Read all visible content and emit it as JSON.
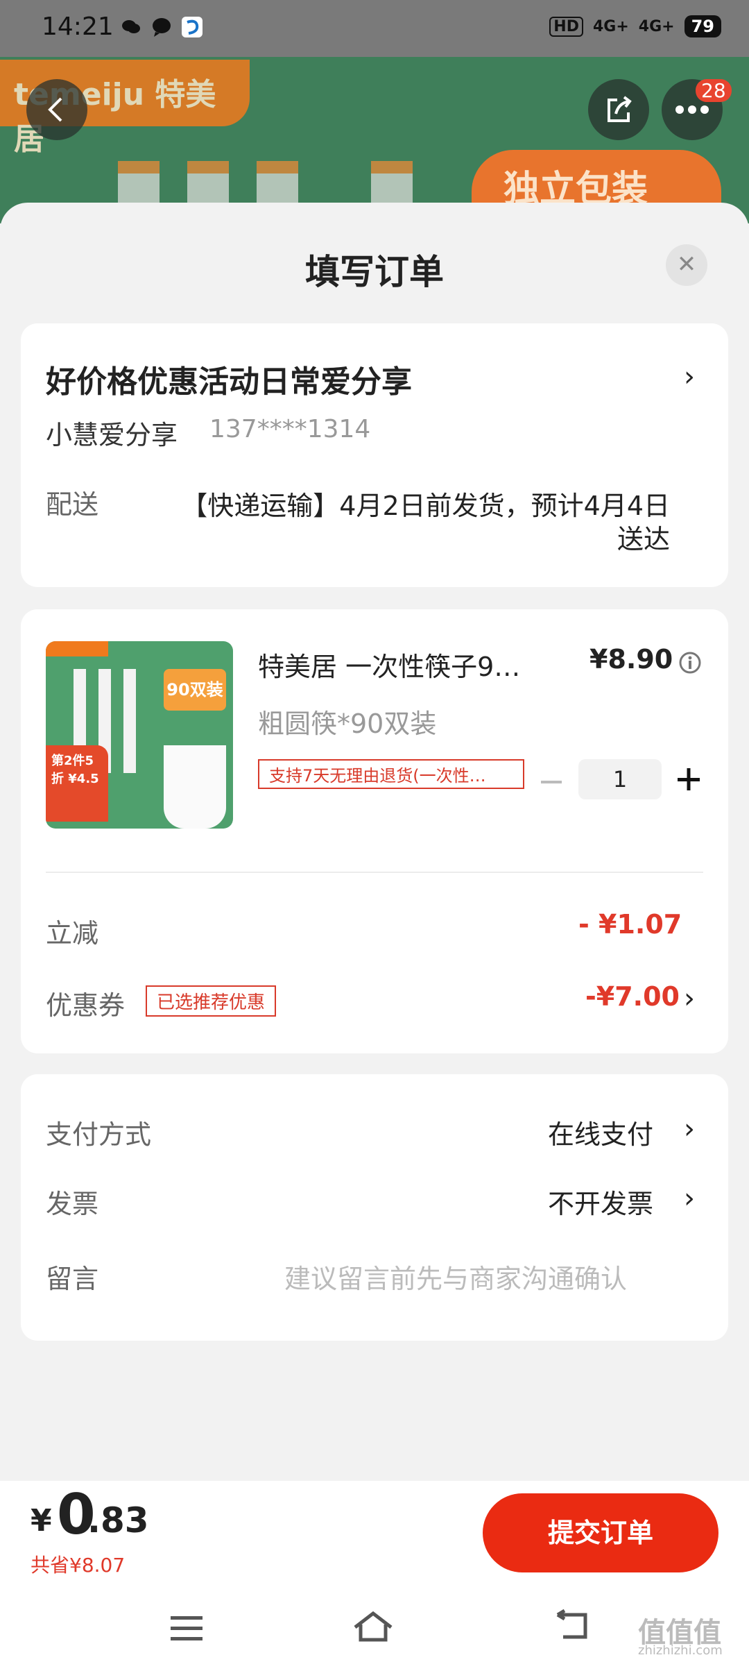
{
  "status_bar": {
    "time": "14:21",
    "network": "4G+",
    "network2": "4G+",
    "hd_label": "HD",
    "battery": "79"
  },
  "hero": {
    "brand": "temeiju 特美居",
    "tag": "独立包装",
    "more_badge": "28"
  },
  "sheet": {
    "title": "填写订单"
  },
  "address": {
    "title": "好价格优惠活动日常爱分享",
    "name": "小慧爱分享",
    "phone": "137****1314",
    "delivery_label": "配送",
    "delivery_line1": "【快递运输】4月2日前发货，预计4月4日",
    "delivery_line2": "送达"
  },
  "product": {
    "name": "特美居 一次性筷子9…",
    "price": "¥8.90",
    "spec": "粗圆筷*90双装",
    "return_tag": "支持7天无理由退货(一次性…",
    "quantity": "1",
    "image_pack_text": "90双装",
    "image_promo_text": "第2件5折 ¥4.5"
  },
  "discounts": {
    "instant_label": "立减",
    "instant_value": "- ¥1.07",
    "coupon_label": "优惠券",
    "coupon_tag": "已选推荐优惠",
    "coupon_value": "-¥7.00"
  },
  "options": {
    "payment_label": "支付方式",
    "payment_value": "在线支付",
    "invoice_label": "发票",
    "invoice_value": "不开发票",
    "note_label": "留言",
    "note_placeholder": "建议留言前先与商家沟通确认"
  },
  "footer": {
    "currency": "¥",
    "amount_int": "0",
    "amount_dec": ".83",
    "saved": "共省¥8.07",
    "submit_label": "提交订单"
  },
  "watermark": {
    "text": "值值值",
    "domain": "zhizhizhi.com"
  },
  "colors": {
    "accent_red": "#e0392a",
    "button_red": "#ea2b12"
  }
}
